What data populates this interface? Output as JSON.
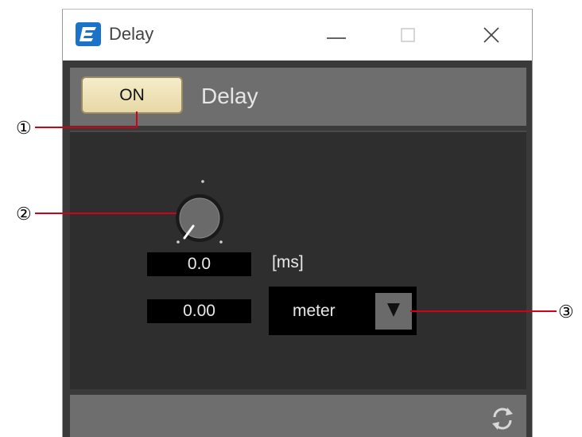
{
  "window": {
    "title": "Delay",
    "app_icon_letter": "E",
    "controls": [
      "minimize",
      "maximize",
      "close"
    ]
  },
  "header": {
    "on_button_label": "ON",
    "title": "Delay"
  },
  "delay": {
    "time_value": "0.0",
    "time_unit": "[ms]",
    "distance_value": "0.00",
    "distance_unit": "meter"
  },
  "callouts": [
    "①",
    "②",
    "③"
  ],
  "colors": {
    "on_button": "#efe2b8",
    "panel": "#2e2e2e",
    "header": "#6e6e6e",
    "callout_line": "#d0021b",
    "brand": "#1a73c9"
  },
  "icons": {
    "app": "app-logo-icon",
    "minimize": "minimize-icon",
    "maximize": "maximize-icon",
    "close": "close-icon",
    "dropdown": "triangle-down-icon",
    "sync": "sync-icon"
  }
}
